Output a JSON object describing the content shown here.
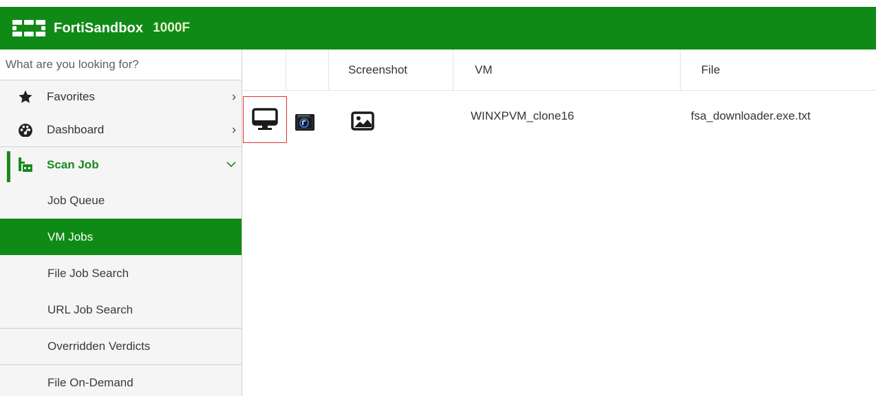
{
  "header": {
    "app_name": "FortiSandbox",
    "model": "1000F",
    "logo_icon": "fortinet-logo-icon",
    "bg_color": "#108a16"
  },
  "sidebar": {
    "search_placeholder": "What are you looking for?",
    "items": [
      {
        "label": "Favorites",
        "icon": "star-icon",
        "arrow": ">"
      },
      {
        "label": "Dashboard",
        "icon": "speedometer-icon",
        "arrow": ">"
      },
      {
        "label": "Scan Job",
        "icon": "scan-job-icon",
        "arrow": "v",
        "expanded": true
      }
    ],
    "sub_items": [
      {
        "label": "Job Queue"
      },
      {
        "label": "VM Jobs",
        "active": true
      },
      {
        "label": "File Job Search"
      },
      {
        "label": "URL Job Search"
      },
      {
        "label": "Overridden Verdicts"
      },
      {
        "label": "File On-Demand"
      }
    ]
  },
  "table": {
    "columns": [
      "",
      "",
      "Screenshot",
      "VM",
      "File"
    ],
    "rows": [
      {
        "vm": "WINXPVM_clone16",
        "file": "fsa_downloader.exe.txt",
        "icons": [
          "monitor-icon",
          "vm-console-icon",
          "image-icon"
        ]
      }
    ]
  },
  "colors": {
    "accent": "#108a16",
    "highlight_border": "#e03030"
  }
}
